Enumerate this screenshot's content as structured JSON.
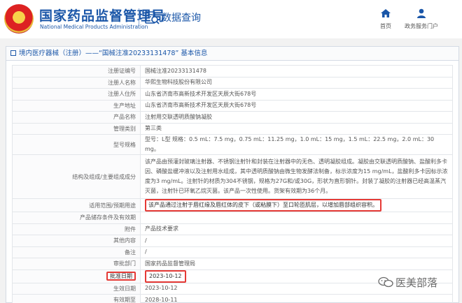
{
  "header": {
    "site_title": "国家药品监督管理局",
    "site_subtitle": "National Medical Products Administration",
    "section_label": "数据查询",
    "nav": [
      {
        "label": "首页",
        "icon": "home-icon"
      },
      {
        "label": "政务服务门户",
        "icon": "user-icon"
      }
    ]
  },
  "panel": {
    "breadcrumb": "境内医疗器械（注册）——“国械注准20233131478” 基本信息"
  },
  "record": [
    {
      "key": "注册证编号",
      "value": "国械注准20233131478"
    },
    {
      "key": "注册人名称",
      "value": "华熙生物科技股份有限公司"
    },
    {
      "key": "注册人住所",
      "value": "山东省济南市高新技术开发区天辰大街678号"
    },
    {
      "key": "生产地址",
      "value": "山东省济南市高新技术开发区天辰大街678号"
    },
    {
      "key": "产品名称",
      "value": "注射用交联透明质酸钠凝胶"
    },
    {
      "key": "管理类别",
      "value": "第三类"
    },
    {
      "key": "型号规格",
      "value": "型号：L型 规格：0.5 mL：7.5 mg，0.75 mL：11.25 mg，1.0 mL：15 mg，1.5 mL：22.5 mg，2.0 mL：30 mg。"
    },
    {
      "key": "结构及组成/主要组成成分",
      "value": "该产品由预灌封玻璃注射器、不锈钢注射针和封装在注射器中的无色、透明凝胶组成。凝胶由交联透明质酸钠、盐酸利多卡因、磷酸盐缓冲液以及注射用水组成，其中透明质酸钠由微生物发酵法制备，标示浓度为15 mg/mL，盐酸利多卡因标示浓度为3 mg/mL。注射针的材质为304不锈钢，规格为27G和/或30G，形状为直形钢针。封装了凝胶的注射器已经高温蒸汽灭菌，注射针已环氧乙烷灭菌。该产品一次性使用。货架有效期为36个月。"
    },
    {
      "key": "适用范围/预期用途",
      "value": "该产品通过注射于唇红缘及唇红体的皮下（或粘膜下）至口轮匝肌层，以增加唇部组织容积。"
    },
    {
      "key": "产品储存条件及有效期",
      "value": ""
    },
    {
      "key": "附件",
      "value": "产品技术要求"
    },
    {
      "key": "其他内容",
      "value": "/"
    },
    {
      "key": "备注",
      "value": "/"
    },
    {
      "key": "审批部门",
      "value": "国家药品监督管理局"
    },
    {
      "key": "批准日期",
      "value": "2023-10-12"
    },
    {
      "key": "生效日期",
      "value": "2023-10-12"
    },
    {
      "key": "有效期至",
      "value": "2028-10-11"
    }
  ],
  "watermark": "医美部落",
  "colors": {
    "accent": "#1a56a8",
    "highlight": "#e53935"
  }
}
